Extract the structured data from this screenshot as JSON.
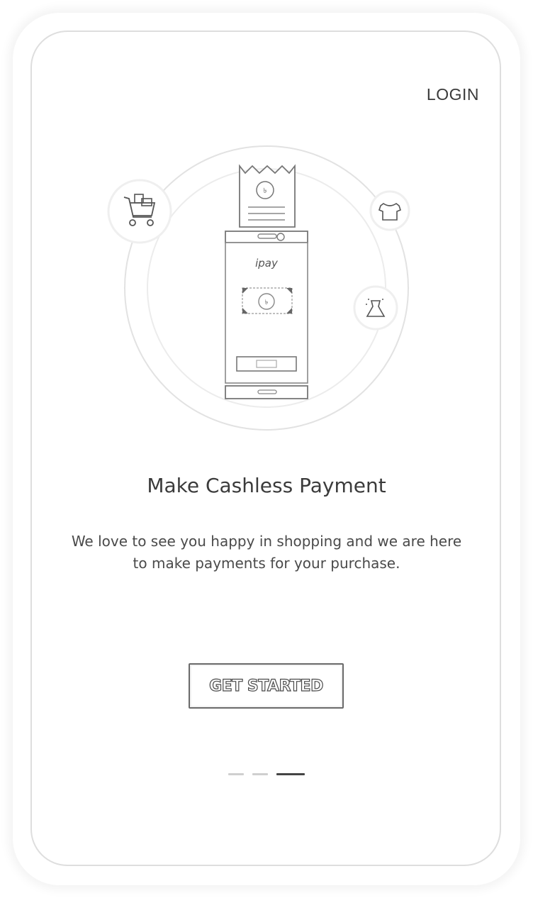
{
  "header": {
    "login_label": "LOGIN"
  },
  "illustration": {
    "brand_text": "ipay",
    "icons": [
      "cart-icon",
      "shirt-icon",
      "dress-icon"
    ]
  },
  "onboarding": {
    "title": "Make Cashless Payment",
    "description": "We love to see you happy in shopping and we are here to make payments for your purchase.",
    "cta_label": "GET STARTED"
  },
  "pager": {
    "total": 3,
    "active_index": 2
  },
  "colors": {
    "text_dark": "#3b3b3b",
    "line": "#8a8a8a",
    "indicator_active": "#444444",
    "indicator_inactive": "#cfcfcf"
  }
}
